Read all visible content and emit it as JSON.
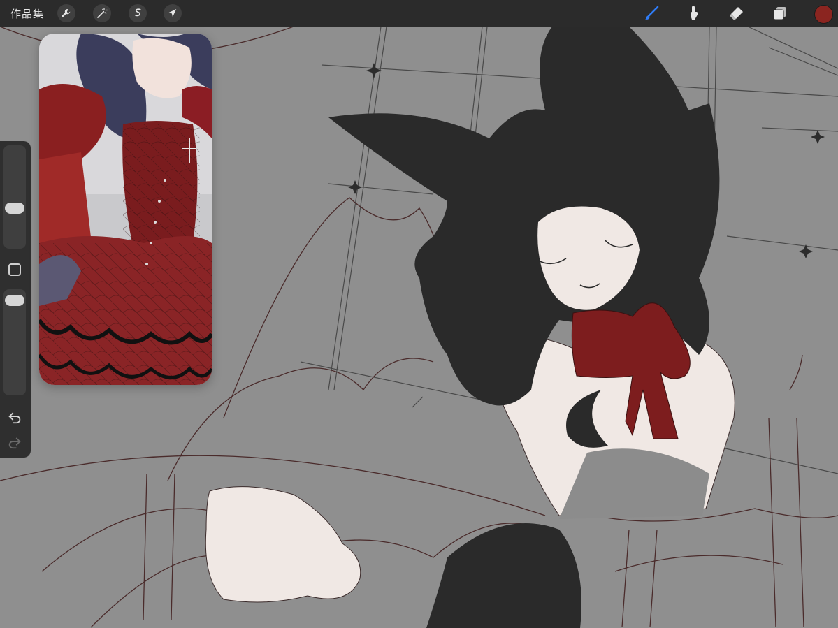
{
  "topbar": {
    "gallery_label": "作品集",
    "left_tools": [
      {
        "name": "actions",
        "icon": "wrench-icon"
      },
      {
        "name": "adjustments",
        "icon": "magic-wand-icon"
      },
      {
        "name": "selection",
        "icon": "selection-s-icon"
      },
      {
        "name": "transform",
        "icon": "arrow-cursor-icon"
      }
    ],
    "right_tools": [
      {
        "name": "brush",
        "icon": "brush-icon",
        "active": true
      },
      {
        "name": "smudge",
        "icon": "smudge-icon",
        "active": false
      },
      {
        "name": "eraser",
        "icon": "eraser-icon",
        "active": false
      },
      {
        "name": "layers",
        "icon": "layers-icon",
        "active": false
      }
    ],
    "current_color": "#8b2520",
    "active_tool_color": "#2f7cf6"
  },
  "sidebar": {
    "brush_size_level": 0.58,
    "opacity_level": 0.15,
    "icons": [
      "modify-square-icon",
      "undo-icon",
      "redo-icon"
    ]
  },
  "colors": {
    "canvas_gray": "#8f8f8f",
    "hair_black": "#2a2a2a",
    "skin": "#f0e8e4",
    "ribbon_red": "#7d1d1e",
    "line_brown": "#4a2b2b"
  }
}
